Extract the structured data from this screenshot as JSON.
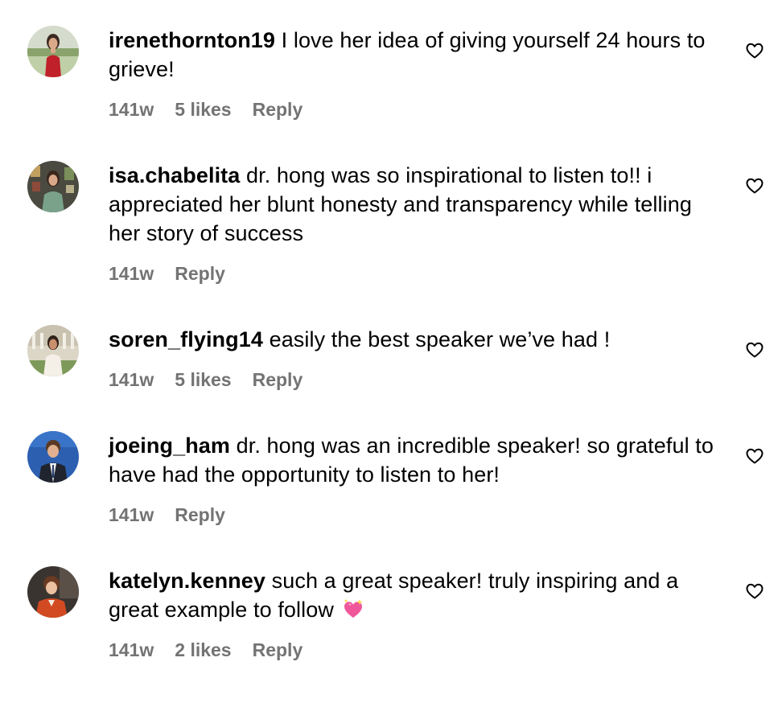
{
  "colors": {
    "text": "#000000",
    "meta": "#737373",
    "background": "#ffffff"
  },
  "comments": [
    {
      "username": "irenethornton19",
      "text": "I love her idea of giving yourself 24 hours to grieve!",
      "time": "141w",
      "likes": "5 likes",
      "reply": "Reply",
      "avatar": "avatar-icon-red-dress"
    },
    {
      "username": "isa.chabelita",
      "text": "dr. hong was so inspirational to listen to!! i appreciated her blunt honesty and transparency while telling her story of success",
      "time": "141w",
      "likes": null,
      "reply": "Reply",
      "avatar": "avatar-icon-art-wall"
    },
    {
      "username": "soren_flying14",
      "text": "easily the best speaker we’ve had !",
      "time": "141w",
      "likes": "5 likes",
      "reply": "Reply",
      "avatar": "avatar-icon-white-dress"
    },
    {
      "username": "joeing_ham",
      "text": "dr. hong was an incredible speaker! so grateful to have had the opportunity to listen to her!",
      "time": "141w",
      "likes": null,
      "reply": "Reply",
      "avatar": "avatar-icon-suit-blue"
    },
    {
      "username": "katelyn.kenney",
      "text": "such a great speaker! truly inspiring and a great example to follow",
      "emoji": "sparkling-heart-emoji",
      "time": "141w",
      "likes": "2 likes",
      "reply": "Reply",
      "avatar": "avatar-icon-orange-jacket"
    }
  ]
}
